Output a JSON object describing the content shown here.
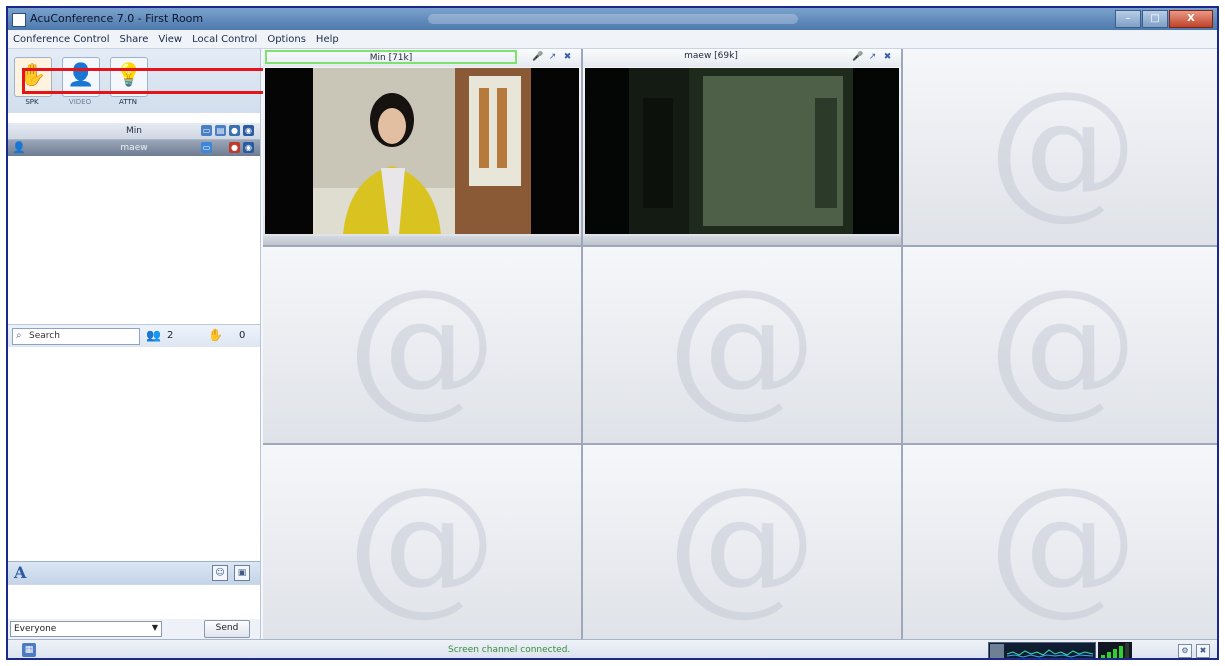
{
  "window": {
    "title": "AcuConference 7.0 - First Room",
    "controls": [
      "–",
      "□",
      "X"
    ]
  },
  "menu": [
    "Conference Control",
    "Share",
    "View",
    "Local Control",
    "Options",
    "Help"
  ],
  "toolbar": {
    "buttons": [
      {
        "label": "SPK",
        "icon": "raise-hand-icon"
      },
      {
        "label": "VIDEO",
        "icon": "presenter-icon"
      },
      {
        "label": "ATTN",
        "icon": "attention-bulb-icon"
      }
    ]
  },
  "participants": [
    {
      "name": "Min"
    },
    {
      "name": "maew"
    }
  ],
  "search": {
    "placeholder": "Search",
    "participant_count": "2",
    "hand_count": "0"
  },
  "chat": {
    "recipient": "Everyone",
    "send_label": "Send"
  },
  "videos": [
    {
      "label": "Min [71k]"
    },
    {
      "label": "maew [69k]"
    }
  ],
  "status": {
    "message": "Screen channel connected.",
    "signal_level": 4
  },
  "colors": {
    "highlight_box": "#e4141b",
    "active_speaker_border": "#7ee36e",
    "status_text": "#3a8b36"
  }
}
